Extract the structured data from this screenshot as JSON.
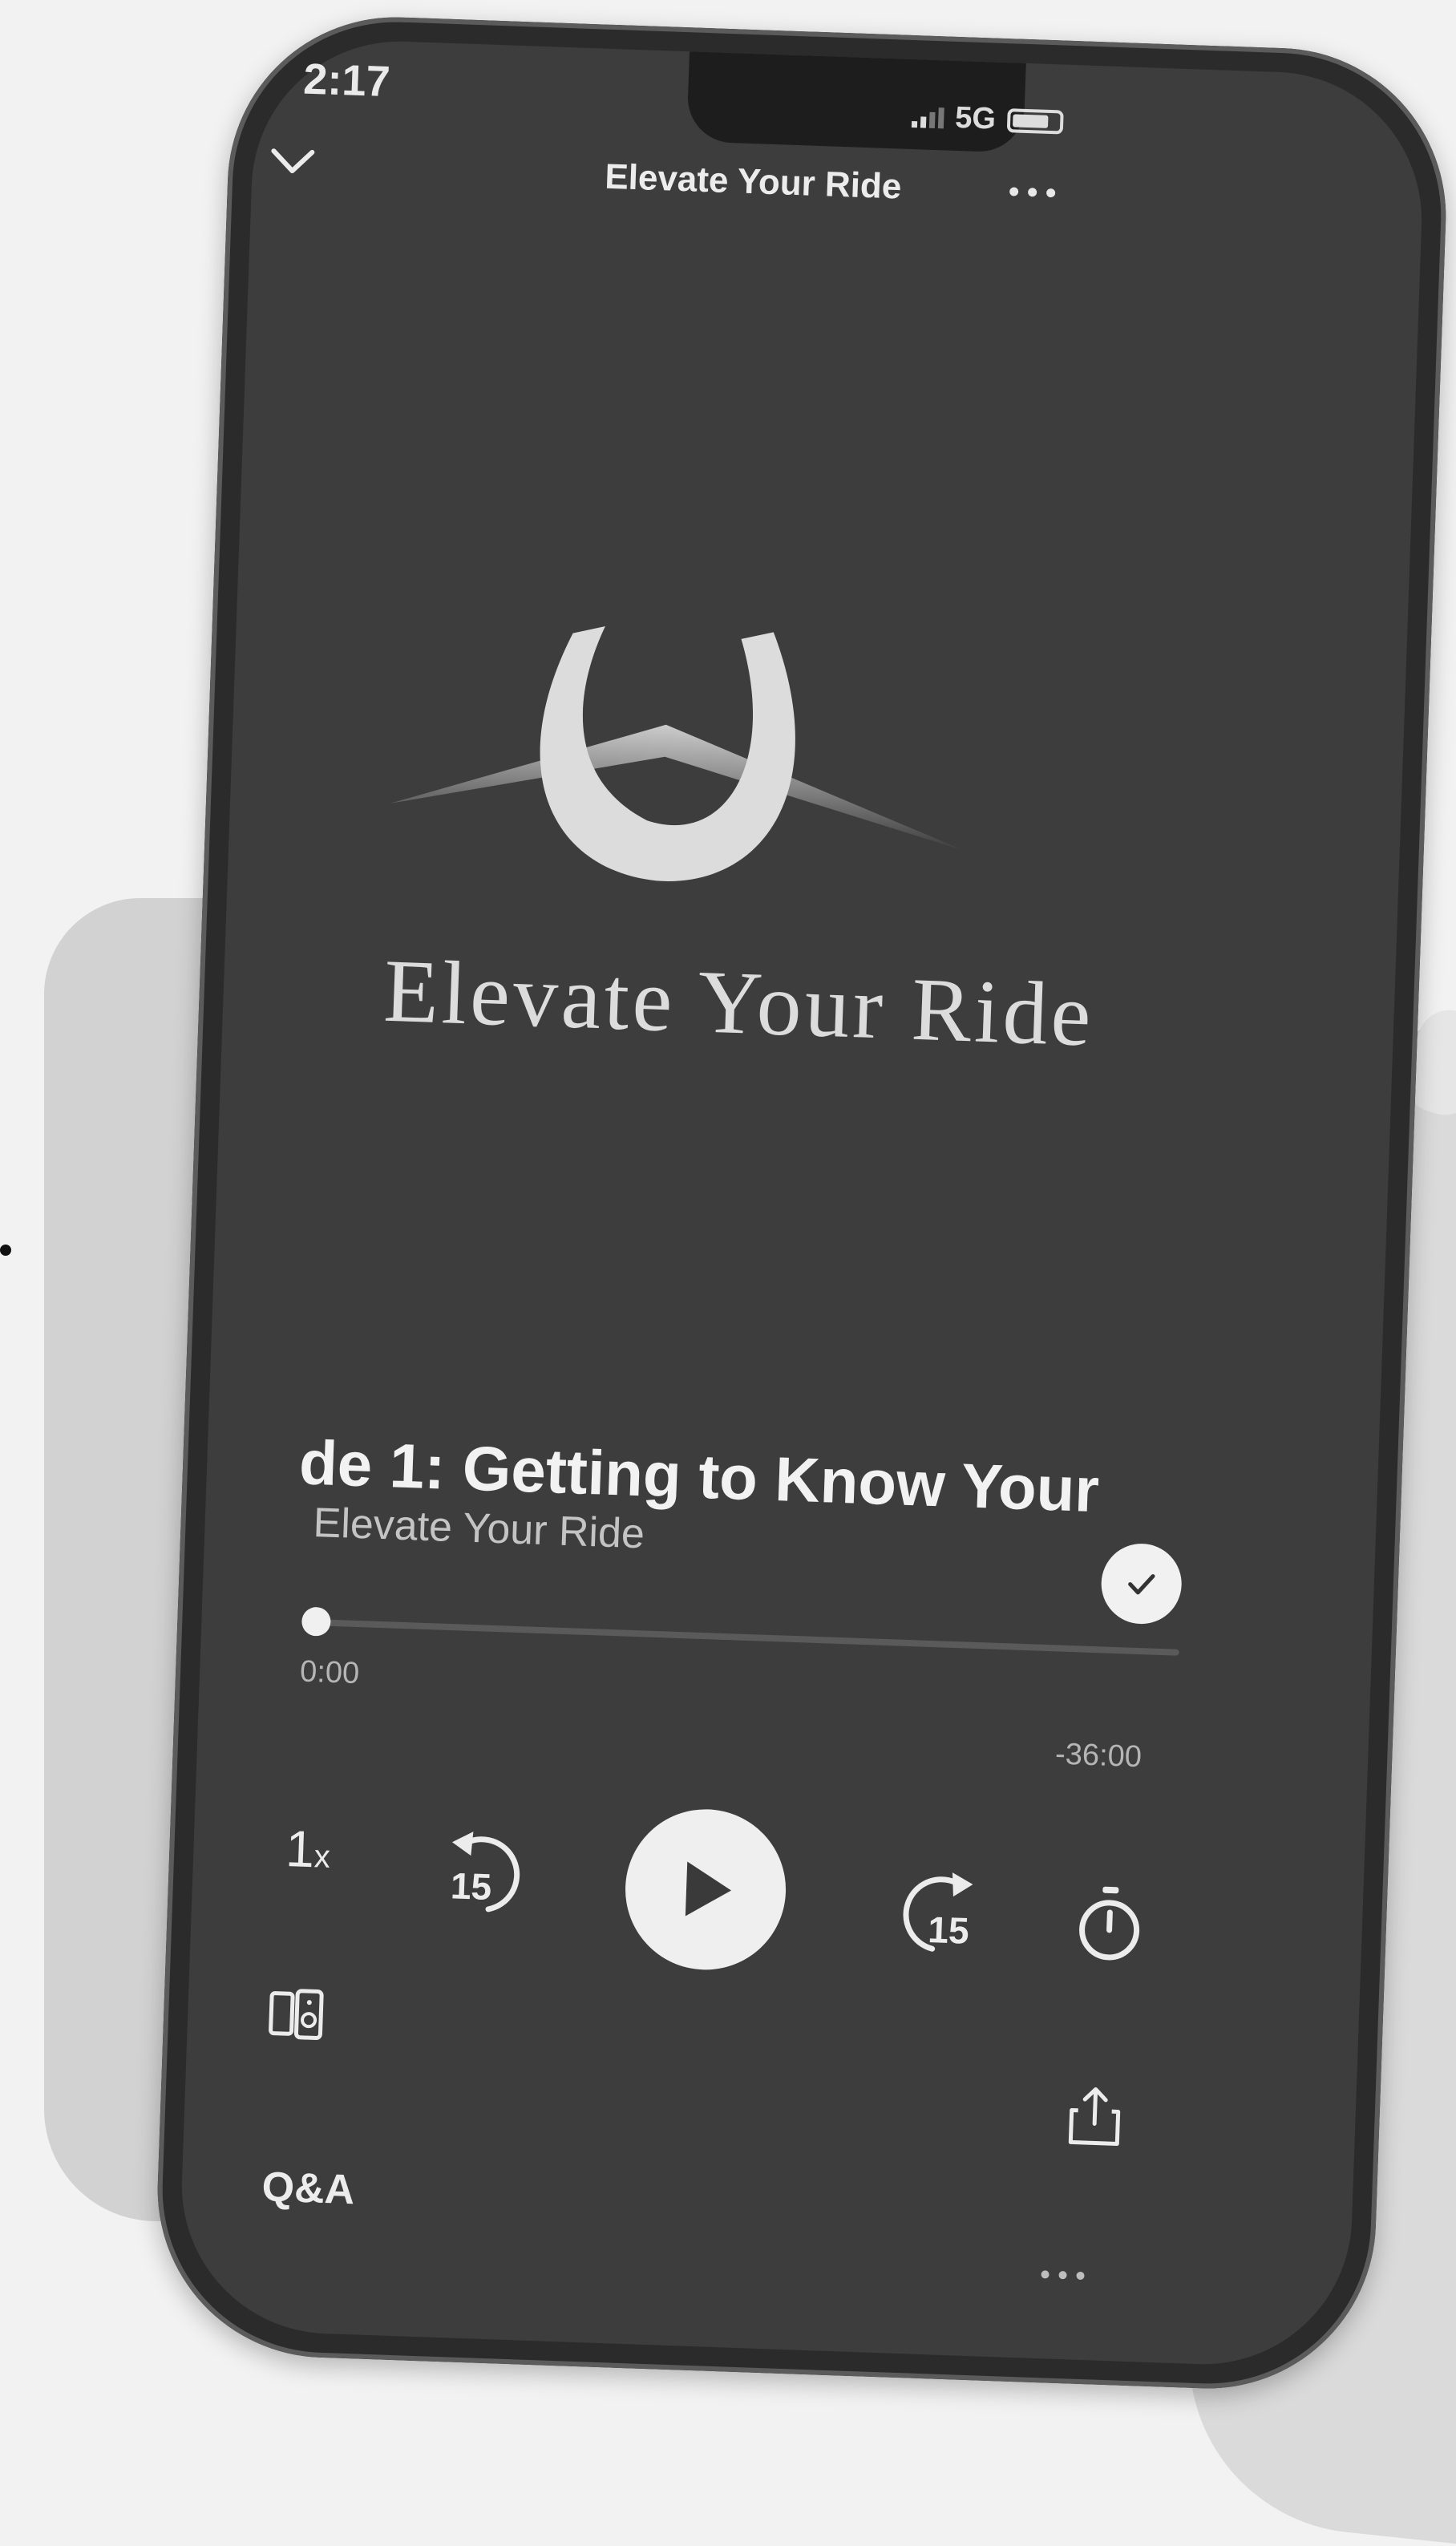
{
  "status_bar": {
    "time": "2:17",
    "network": "5G"
  },
  "header": {
    "title": "Elevate Your Ride",
    "collapse_icon": "chevron-down-icon",
    "more_icon": "more-horizontal-icon"
  },
  "artwork": {
    "logo_icon": "horseshoe-icon",
    "logo_text": "Elevate Your Ride"
  },
  "episode": {
    "title": "de 1: Getting to Know Your",
    "show": "Elevate Your Ride",
    "completed_icon": "check-icon"
  },
  "playback": {
    "elapsed": "0:00",
    "remaining": "-36:00",
    "progress": 0.0,
    "speed_value": "1",
    "speed_suffix": "x",
    "skip_back_seconds": "15",
    "skip_forward_seconds": "15"
  },
  "bottom": {
    "qa_label": "Q&A",
    "device_icon": "connect-device-icon",
    "share_icon": "share-icon"
  },
  "colors": {
    "screen": "#3d3d3d",
    "text": "#ececec",
    "accent": "#efefef"
  }
}
